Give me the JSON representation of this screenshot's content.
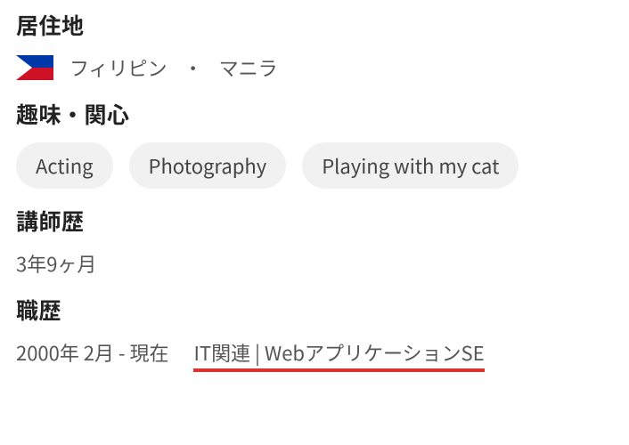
{
  "sections": {
    "location": {
      "heading": "居住地",
      "country": "フィリピン",
      "separator": "・",
      "city": "マニラ",
      "flag_name": "flag-philippines"
    },
    "hobbies": {
      "heading": "趣味・関心",
      "tags": [
        "Acting",
        "Photography",
        "Playing with my cat"
      ]
    },
    "teaching": {
      "heading": "講師歴",
      "value": "3年9ヶ月"
    },
    "career": {
      "heading": "職歴",
      "period": "2000年 2月 - 現在",
      "role": "IT関連 | WebアプリケーションSE"
    }
  }
}
